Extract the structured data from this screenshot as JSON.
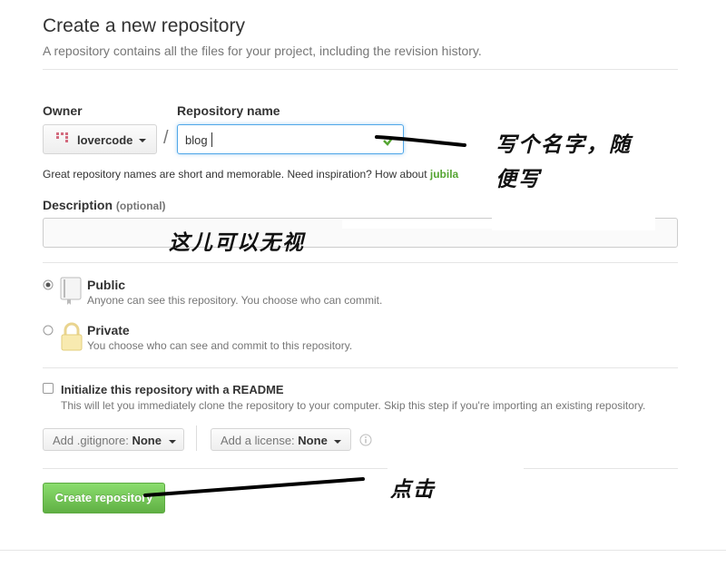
{
  "page": {
    "title": "Create a new repository",
    "subtitle": "A repository contains all the files for your project, including the revision history."
  },
  "owner": {
    "label": "Owner",
    "value": "lovercode"
  },
  "repo": {
    "label": "Repository name",
    "value": "blog",
    "separator": "/"
  },
  "hint": {
    "text": "Great repository names are short and memorable. Need inspiration? How about ",
    "suggestion": "jubila"
  },
  "description": {
    "label": "Description",
    "optional": "(optional)",
    "value": ""
  },
  "visibility": {
    "public": {
      "label": "Public",
      "desc": "Anyone can see this repository. You choose who can commit.",
      "selected": true
    },
    "private": {
      "label": "Private",
      "desc": "You choose who can see and commit to this repository.",
      "selected": false
    }
  },
  "readme": {
    "label": "Initialize this repository with a README",
    "desc": "This will let you immediately clone the repository to your computer. Skip this step if you're importing an existing repository."
  },
  "gitignore": {
    "label": "Add .gitignore:",
    "value": "None"
  },
  "license": {
    "label": "Add a license:",
    "value": "None"
  },
  "submit": {
    "label": "Create repository"
  },
  "annotations": {
    "name_note_line1": "写个名字，随",
    "name_note_line2": "便写",
    "desc_note": "这儿可以无视",
    "click_note": "点击"
  },
  "colors": {
    "accent": "#6cc644",
    "valid": "#55a532",
    "link": "#4183c4"
  }
}
